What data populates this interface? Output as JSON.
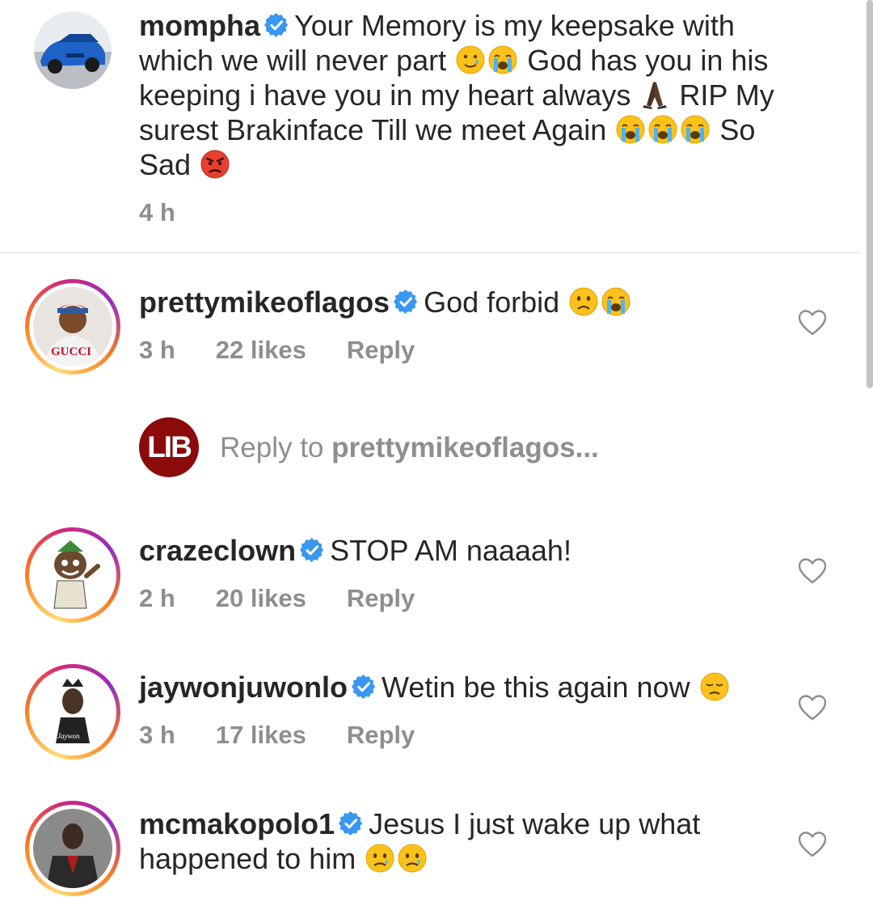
{
  "caption": {
    "username": "mompha",
    "text_1": "Your Memory is my keepsake with which we will never part",
    "text_2": "God has you in his keeping i have you in my heart always",
    "text_3": "RIP My surest Brakinface Till we meet Again",
    "text_4": "So Sad",
    "time": "4 h",
    "emojis": [
      "smiling-face-with-tear",
      "loudly-crying",
      "folded-hands",
      "loudly-crying",
      "loudly-crying",
      "loudly-crying",
      "angry-face"
    ]
  },
  "comments": [
    {
      "username": "prettymikeoflagos",
      "text": "God forbid",
      "time": "3 h",
      "likes": "22 likes",
      "reply": "Reply",
      "emojis": [
        "frowning-face",
        "loudly-crying"
      ]
    },
    {
      "username": "crazeclown",
      "text": "STOP AM naaaah!",
      "time": "2 h",
      "likes": "20 likes",
      "reply": "Reply",
      "emojis": []
    },
    {
      "username": "jaywonjuwonlo",
      "text": "Wetin be this again now",
      "time": "3 h",
      "likes": "17 likes",
      "reply": "Reply",
      "emojis": [
        "disappointed-face"
      ]
    },
    {
      "username": "mcmakopolo1",
      "text": "Jesus I just wake up what happened to him",
      "emojis": [
        "crying-face",
        "crying-face"
      ]
    }
  ],
  "reply_box": {
    "logo_text": "LIB",
    "prefix": "Reply to ",
    "target": "prettymikeoflagos..."
  },
  "colors": {
    "text": "#262626",
    "meta": "#8e8e8e",
    "verified": "#3897f0",
    "lib": "#8b0b0b"
  }
}
